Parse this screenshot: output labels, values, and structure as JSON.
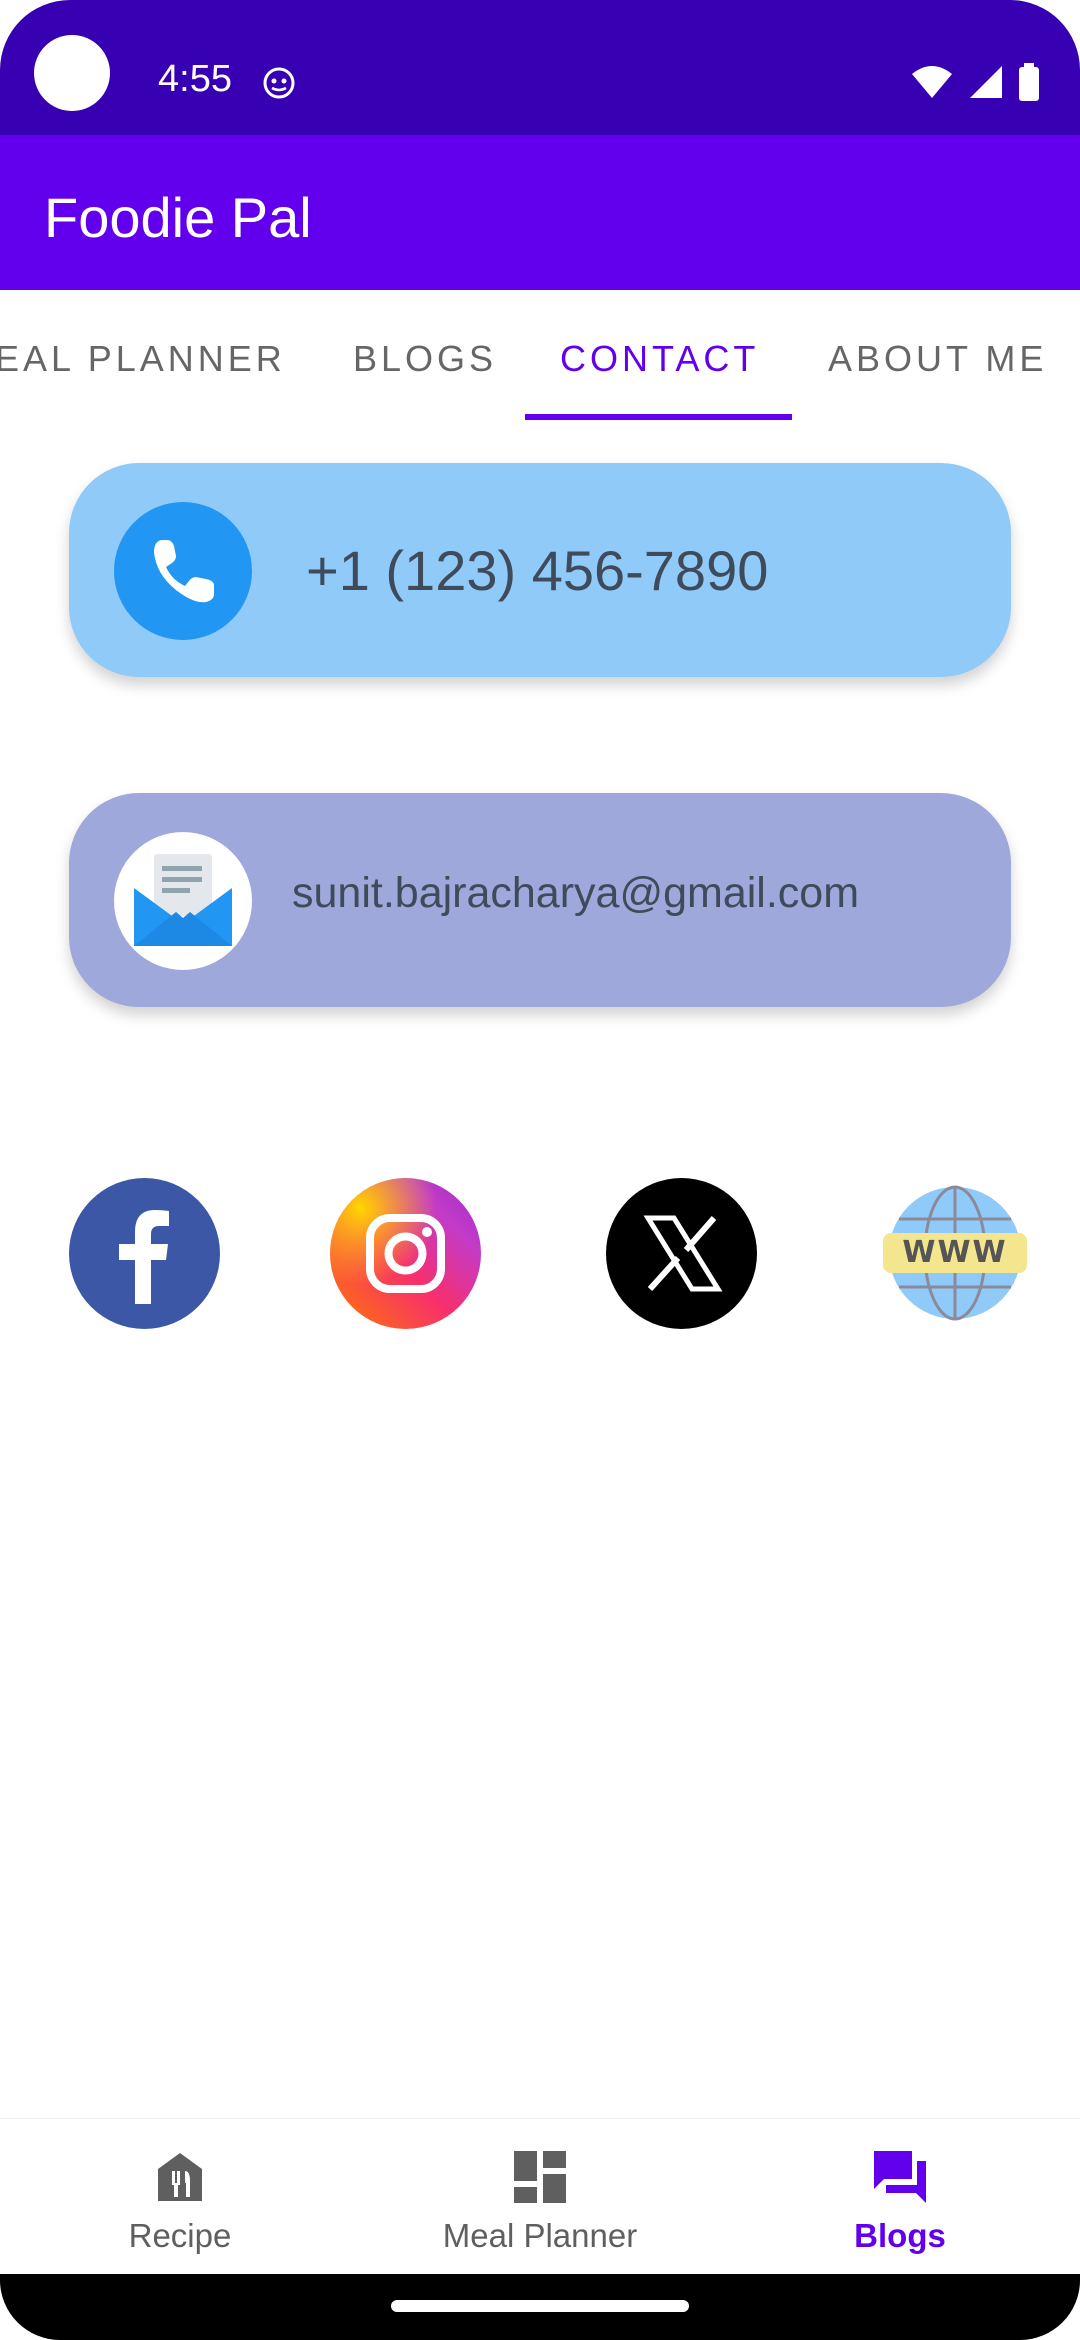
{
  "status_bar": {
    "time": "4:55"
  },
  "app_bar": {
    "title": "Foodie Pal"
  },
  "tabs": [
    {
      "label": "EAL PLANNER",
      "active": false
    },
    {
      "label": "BLOGS",
      "active": false
    },
    {
      "label": "CONTACT",
      "active": true
    },
    {
      "label": "ABOUT ME",
      "active": false
    }
  ],
  "contact": {
    "phone": "+1 (123) 456-7890",
    "email": "sunit.bajracharya@gmail.com"
  },
  "social": {
    "website_label": "WWW"
  },
  "bottom_nav": [
    {
      "label": "Recipe",
      "icon": "restaurant-icon",
      "active": false
    },
    {
      "label": "Meal Planner",
      "icon": "dashboard-icon",
      "active": false
    },
    {
      "label": "Blogs",
      "icon": "forum-icon",
      "active": true
    }
  ],
  "colors": {
    "status_bar": "#3700b3",
    "primary": "#6200ee",
    "phone_card": "#90caf9",
    "email_card": "#9fa8da"
  }
}
